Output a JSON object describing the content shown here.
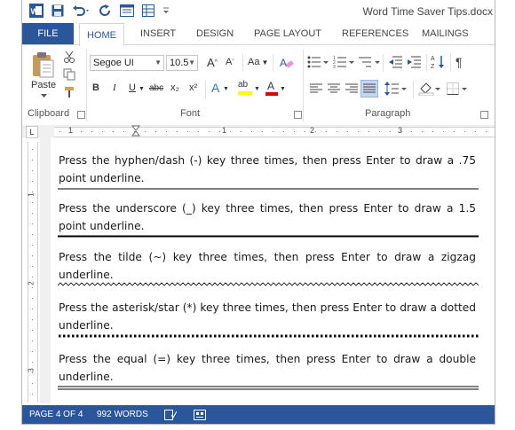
{
  "window": {
    "title": "Word Time Saver Tips.docx"
  },
  "tabs": {
    "file": "FILE",
    "home": "HOME",
    "insert": "INSERT",
    "design": "DESIGN",
    "page_layout": "PAGE LAYOUT",
    "references": "REFERENCES",
    "mailings": "MAILINGS"
  },
  "ribbon": {
    "clipboard": {
      "label": "Clipboard",
      "paste": "Paste"
    },
    "font": {
      "label": "Font",
      "font_name": "Segoe UI",
      "font_size": "10.5",
      "bold": "B",
      "italic": "I",
      "underline": "U",
      "strike": "abc",
      "subscript": "x₂",
      "superscript": "x²",
      "grow": "A",
      "shrink": "A",
      "change_case": "Aa",
      "text_effects": "A",
      "highlight": "ab",
      "font_color": "A"
    },
    "paragraph": {
      "label": "Paragraph"
    }
  },
  "ruler": {
    "marks": [
      "1",
      "1",
      "2",
      "3"
    ],
    "vmarks": [
      "1",
      "2",
      "3"
    ]
  },
  "document": {
    "paragraphs": [
      {
        "text": "Press the hyphen/dash (-) key three times, then press Enter to draw a .75 point underline.",
        "underline": "single-thin"
      },
      {
        "text": "Press the underscore (_) key three times, then press Enter to draw a 1.5 point underline.",
        "underline": "single-thick"
      },
      {
        "text": "Press the tilde (~) key three times, then press Enter to draw a zigzag underline.",
        "underline": "zigzag"
      },
      {
        "text": "Press the asterisk/star (*) key three times, then press Enter to draw a dotted underline.",
        "underline": "dotted"
      },
      {
        "text": "Press the equal (=) key three times, then press Enter to draw a double underline.",
        "underline": "double"
      }
    ]
  },
  "status": {
    "page": "PAGE 4 OF 4",
    "words": "992 WORDS"
  },
  "colors": {
    "accent": "#2b579a",
    "highlight_yellow": "#ffff00",
    "font_red": "#e00000"
  }
}
